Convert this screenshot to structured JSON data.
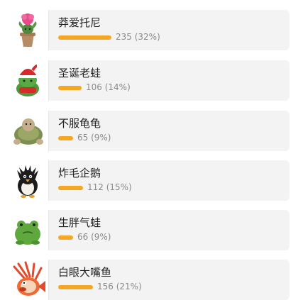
{
  "accent_color": "#f5a623",
  "items": [
    {
      "name": "莽爱托尼",
      "count": 235,
      "percent": 32,
      "stat": "235 (32%)",
      "icon": "potted-plant-plush-icon"
    },
    {
      "name": "圣诞老蛙",
      "count": 106,
      "percent": 14,
      "stat": "106 (14%)",
      "icon": "santa-frog-plush-icon"
    },
    {
      "name": "不服龟龟",
      "count": 65,
      "percent": 9,
      "stat": "65 (9%)",
      "icon": "turtle-plush-icon"
    },
    {
      "name": "炸毛企鹅",
      "count": 112,
      "percent": 15,
      "stat": "112 (15%)",
      "icon": "penguin-plush-icon"
    },
    {
      "name": "生胖气蛙",
      "count": 66,
      "percent": 9,
      "stat": "66 (9%)",
      "icon": "grumpy-frog-plush-icon"
    },
    {
      "name": "白眼大嘴鱼",
      "count": 156,
      "percent": 21,
      "stat": "156 (21%)",
      "icon": "lionfish-plush-icon"
    }
  ]
}
